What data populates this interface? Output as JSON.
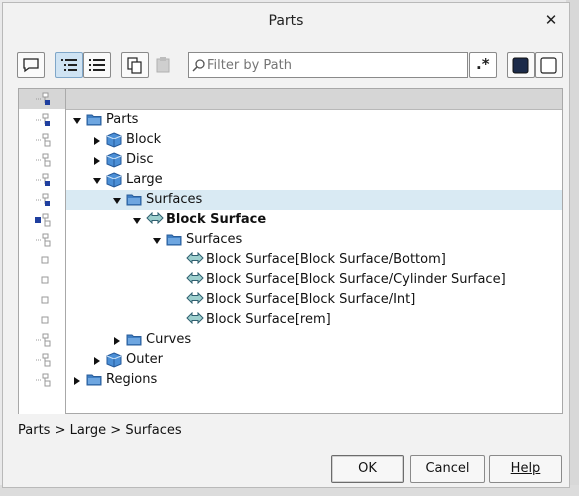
{
  "dialog": {
    "title": "Parts",
    "close_glyph": "✕"
  },
  "toolbar": {
    "filter_placeholder": "Filter by Path",
    "regex_label": ".*"
  },
  "tree": {
    "rows": [
      {
        "label": "Parts",
        "bold": false,
        "icon": "folder-icon"
      },
      {
        "label": "Block",
        "bold": false,
        "icon": "part-icon"
      },
      {
        "label": "Disc",
        "bold": false,
        "icon": "part-icon"
      },
      {
        "label": "Large",
        "bold": false,
        "icon": "part-icon"
      },
      {
        "label": "Surfaces",
        "bold": false,
        "icon": "folder-icon"
      },
      {
        "label": "Block Surface",
        "bold": true,
        "icon": "surface-icon"
      },
      {
        "label": "Surfaces",
        "bold": false,
        "icon": "folder-icon"
      },
      {
        "label": "Block Surface[Block Surface/Bottom]",
        "bold": false,
        "icon": "surface-icon"
      },
      {
        "label": "Block Surface[Block Surface/Cylinder Surface]",
        "bold": false,
        "icon": "surface-icon"
      },
      {
        "label": "Block Surface[Block Surface/Int]",
        "bold": false,
        "icon": "surface-icon"
      },
      {
        "label": "Block Surface[rem]",
        "bold": false,
        "icon": "surface-icon"
      },
      {
        "label": "Curves",
        "bold": false,
        "icon": "folder-icon"
      },
      {
        "label": "Outer",
        "bold": false,
        "icon": "part-icon"
      },
      {
        "label": "Regions",
        "bold": false,
        "icon": "folder-icon"
      }
    ]
  },
  "breadcrumb": "Parts > Large > Surfaces",
  "buttons": {
    "ok": "OK",
    "cancel": "Cancel",
    "help": "Help"
  },
  "colors": {
    "selection": "#d9eaf3",
    "folder_blue": "#3f7fc4",
    "marker_blue": "#1f3f9f"
  }
}
